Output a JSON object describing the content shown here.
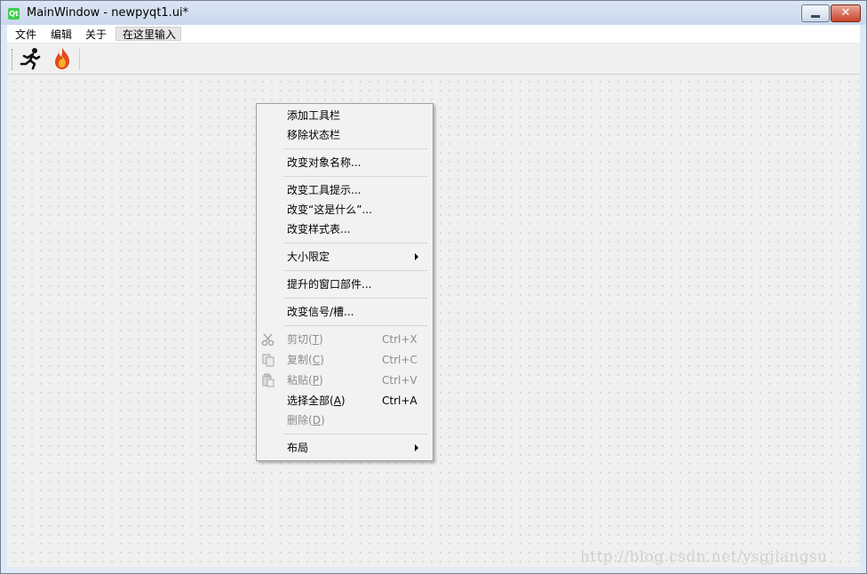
{
  "window": {
    "title": "MainWindow - newpyqt1.ui*",
    "app_icon_text": "Qt",
    "close_symbol": "✕"
  },
  "menubar": {
    "items": [
      "文件",
      "编辑",
      "关于"
    ],
    "input_placeholder": "在这里输入"
  },
  "toolbar": {
    "actions": [
      {
        "icon": "running-man-icon"
      },
      {
        "icon": "fire-icon"
      }
    ]
  },
  "context_menu": {
    "items": [
      {
        "label": "添加工具栏",
        "enabled": true
      },
      {
        "label": "移除状态栏",
        "enabled": true
      },
      {
        "label": "改变对象名称...",
        "enabled": true
      },
      {
        "label": "改变工具提示...",
        "enabled": true
      },
      {
        "label": "改变“这是什么”...",
        "enabled": true
      },
      {
        "label": "改变样式表...",
        "enabled": true
      },
      {
        "label": "大小限定",
        "enabled": true,
        "submenu": true
      },
      {
        "label": "提升的窗口部件...",
        "enabled": true
      },
      {
        "label": "改变信号/槽...",
        "enabled": true
      },
      {
        "label": "剪切(",
        "mnemonic": "T",
        "label_end": ")",
        "shortcut": "Ctrl+X",
        "enabled": false,
        "icon": "scissors-icon"
      },
      {
        "label": "复制(",
        "mnemonic": "C",
        "label_end": ")",
        "shortcut": "Ctrl+C",
        "enabled": false,
        "icon": "copy-icon"
      },
      {
        "label": "粘贴(",
        "mnemonic": "P",
        "label_end": ")",
        "shortcut": "Ctrl+V",
        "enabled": false,
        "icon": "paste-icon"
      },
      {
        "label": "选择全部(",
        "mnemonic": "A",
        "label_end": ")",
        "shortcut": "Ctrl+A",
        "enabled": true
      },
      {
        "label": "删除(",
        "mnemonic": "D",
        "label_end": ")",
        "enabled": false
      },
      {
        "label": "布局",
        "enabled": true,
        "submenu": true
      }
    ]
  },
  "watermark": "http://blog.csdn.net/ysgjiangsu"
}
